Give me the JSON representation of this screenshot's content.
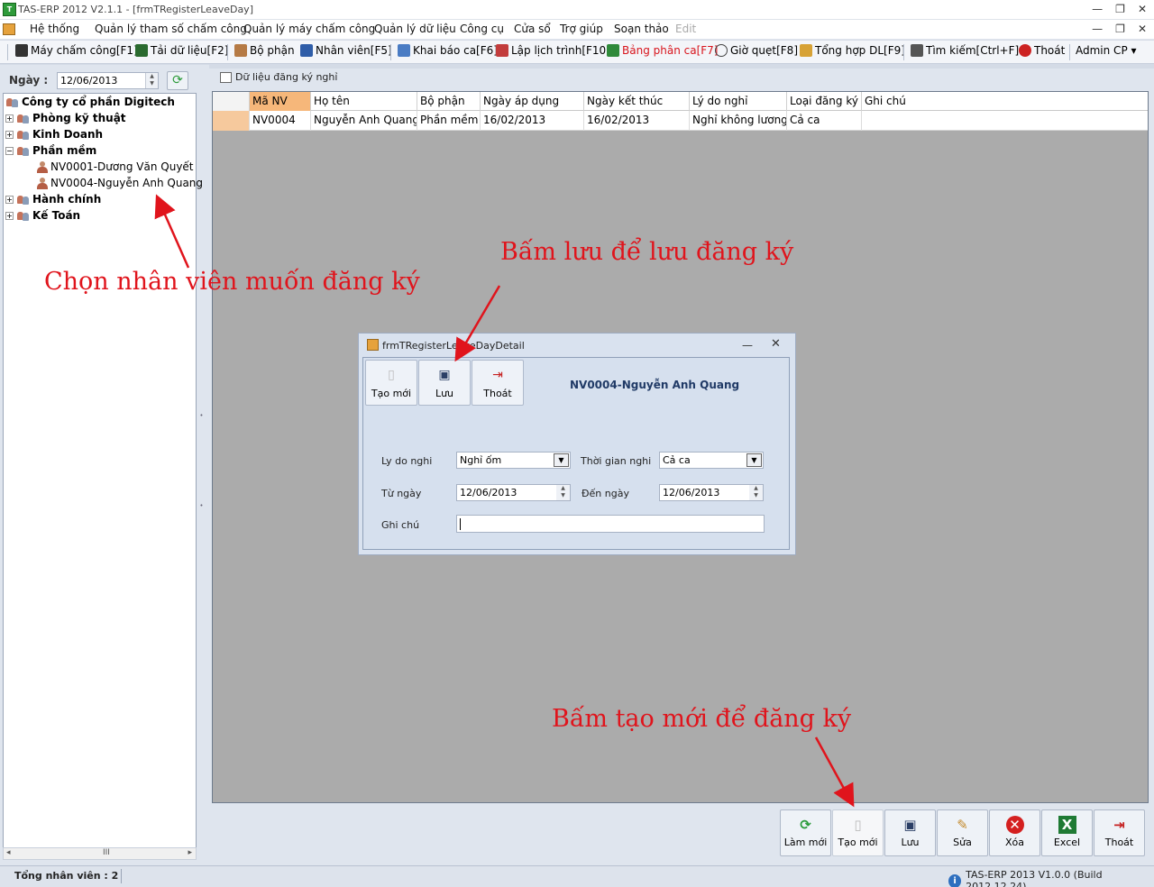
{
  "window": {
    "title": "TAS-ERP 2012 V2.1.1 - [frmTRegisterLeaveDay]",
    "min": "—",
    "restore": "❐",
    "close": "✕",
    "child_min": "—",
    "child_restore": "❐",
    "child_close": "✕"
  },
  "menu": [
    "Hệ thống",
    "Quản lý tham số chấm công",
    "Quản lý máy chấm công",
    "Quản lý dữ liệu",
    "Công cụ",
    "Cửa sổ",
    "Trợ giúp",
    "Soạn thảo",
    "Edit"
  ],
  "toolbar": [
    {
      "label": "Máy chấm công[F1]",
      "icon": "machine-icon"
    },
    {
      "label": "Tải dữ liệu[F2]",
      "icon": "download-icon"
    },
    {
      "label": "Bộ phận",
      "icon": "department-icon"
    },
    {
      "label": "Nhân viên[F5]",
      "icon": "employee-icon"
    },
    {
      "label": "Khai báo ca[F6]",
      "icon": "shift-declare-icon"
    },
    {
      "label": "Lập lịch trình[F10]",
      "icon": "schedule-icon"
    },
    {
      "label": "Bảng phân ca[F7]",
      "icon": "shift-table-icon"
    },
    {
      "label": "Giờ quẹt[F8]",
      "icon": "clock-icon"
    },
    {
      "label": "Tổng hợp DL[F9]",
      "icon": "summary-icon"
    },
    {
      "label": "Tìm kiếm[Ctrl+F]",
      "icon": "search-icon"
    },
    {
      "label": "Thoát",
      "icon": "power-icon"
    },
    {
      "label": "Admin CP ▾",
      "icon": ""
    }
  ],
  "left": {
    "date_label": "Ngày :",
    "date_value": "12/06/2013",
    "tree": {
      "root": "Công ty cổ phần Digitech",
      "departments": [
        "Phòng kỹ thuật",
        "Kinh Doanh",
        "Phần mềm",
        "Hành chính",
        "Kế Toán"
      ],
      "employees": [
        "NV0001-Dương Văn Quyết",
        "NV0004-Nguyễn Anh Quang"
      ]
    },
    "scroll_grip": "III"
  },
  "main": {
    "tab_label": "Dữ liệu đăng ký nghỉ",
    "columns": [
      "Mã NV",
      "Họ tên",
      "Bộ phận",
      "Ngày áp dụng",
      "Ngày kết thúc",
      "Lý do nghỉ",
      "Loại đăng ký n",
      "Ghi chú"
    ],
    "rows": [
      [
        "NV0004",
        "Nguyễn Anh Quang",
        "Phần mềm",
        "16/02/2013",
        "16/02/2013",
        "Nghỉ không lương",
        "Cả ca",
        ""
      ]
    ]
  },
  "bottom_buttons": [
    {
      "label": "Làm mới",
      "icon": "refresh-icon"
    },
    {
      "label": "Tạo mới",
      "icon": "new-doc-icon"
    },
    {
      "label": "Lưu",
      "icon": "save-icon"
    },
    {
      "label": "Sửa",
      "icon": "edit-icon"
    },
    {
      "label": "Xóa",
      "icon": "delete-icon"
    },
    {
      "label": "Excel",
      "icon": "excel-icon"
    },
    {
      "label": "Thoát",
      "icon": "exit-icon"
    }
  ],
  "dialog": {
    "title": "frmTRegisterLeaveDayDetail",
    "buttons": [
      "Tạo mới",
      "Lưu",
      "Thoát"
    ],
    "employee": "NV0004-Nguyễn Anh Quang",
    "reason_label": "Ly do nghi",
    "reason_value": "Nghỉ ốm",
    "period_label": "Thời gian nghi",
    "period_value": "Cả ca",
    "from_label": "Từ ngày",
    "from_value": "12/06/2013",
    "to_label": "Đến ngày",
    "to_value": "12/06/2013",
    "note_label": "Ghi chú",
    "note_value": ""
  },
  "status": {
    "left": "Tổng nhân viên : 2",
    "right": "TAS-ERP 2013 V1.0.0 (Build 2012.12.24)"
  },
  "annotations": {
    "choose": "Chọn nhân viên muốn đăng ký",
    "save": "Bấm lưu để lưu đăng ký",
    "create": "Bấm tạo mới để đăng ký"
  },
  "colors": {
    "annotation": "#e0141c",
    "selected_header": "#f6b77a",
    "highlight_toolbar": "#d8141c"
  }
}
